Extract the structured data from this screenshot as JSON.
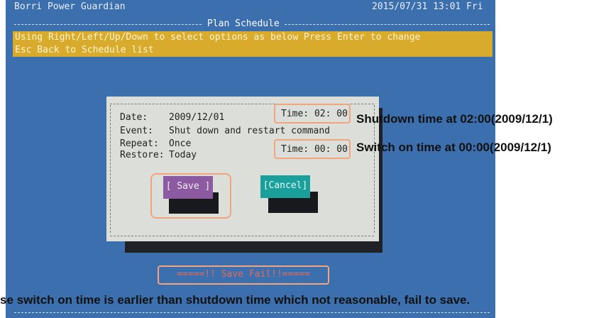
{
  "app": {
    "title": "Borri Power Guardian",
    "datetime": "2015/07/31 13:01 Fri"
  },
  "schedule": {
    "heading": "Plan Schedule",
    "help_line_1": "Using Right/Left/Up/Down to select options as below Press Enter to change",
    "help_line_2": "Esc Back to Schedule list"
  },
  "dialog": {
    "date": {
      "label": "Date:",
      "value": "2009/12/01"
    },
    "event": {
      "label": "Event:",
      "value": "Shut down and restart command"
    },
    "repeat": {
      "label": "Repeat:",
      "value": "Once"
    },
    "restore": {
      "label": "Restore:",
      "value": "Today"
    },
    "shutdown_time": "Time: 02: 00",
    "switch_on_time": "Time: 00: 00",
    "save_label": "[ Save ]",
    "cancel_label": "[Cancel]"
  },
  "status": {
    "save_fail": "=====!! Save Fail!!====="
  },
  "annotations": {
    "shutdown_note": "Shutdown time at 02:00(2009/12/1)",
    "switch_on_note": "Switch on time at 00:00(2009/12/1)",
    "reason_note": "se switch on time is earlier than shutdown time which not reasonable, fail to save."
  },
  "colors": {
    "terminal_bg": "#3b6fae",
    "help_bar": "#d8ab2c",
    "dialog_bg": "#dcdfd9",
    "save_button": "#8b5aa0",
    "cancel_button": "#1aa09a",
    "highlight": "#f4a37f",
    "error_text": "#e56b5a"
  }
}
